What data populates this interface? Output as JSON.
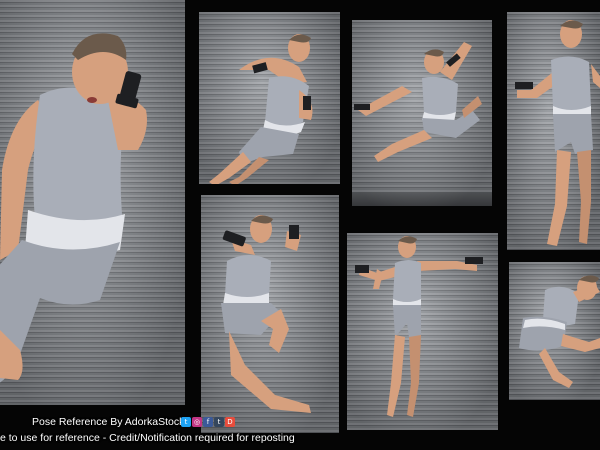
{
  "credit": {
    "title": "Pose Reference By AdorkaStock",
    "usage": "e to use for reference - Credit/Notification required for reposting"
  },
  "social_icons": [
    {
      "name": "twitter-icon",
      "glyph": "t",
      "color": "#1da1f2"
    },
    {
      "name": "instagram-icon",
      "glyph": "◎",
      "color": "#c13584"
    },
    {
      "name": "facebook-icon",
      "glyph": "f",
      "color": "#3b5998"
    },
    {
      "name": "tumblr-icon",
      "glyph": "t",
      "color": "#35465c"
    },
    {
      "name": "deviantart-icon",
      "glyph": "D",
      "color": "#e74c3c"
    }
  ],
  "colors": {
    "skin": "#d6a07e",
    "skin_shadow": "#b47c5c",
    "tank_top": "#a9aeb8",
    "shorts": "#9ea3ad",
    "waistband": "#e3e5ea",
    "gun": "#1e1f22",
    "background": "#050505"
  }
}
